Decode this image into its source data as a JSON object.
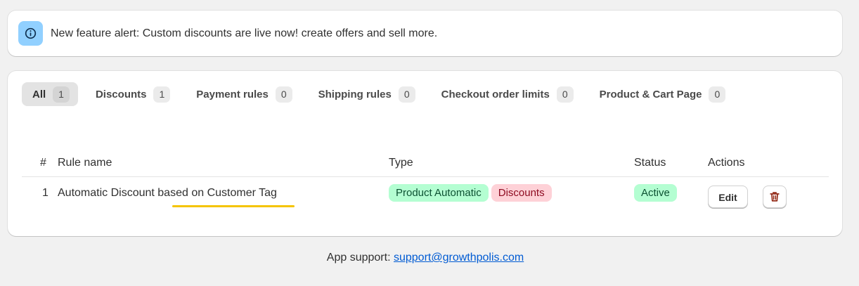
{
  "banner": {
    "text": "New feature alert: Custom discounts are live now! create offers and sell more.",
    "icon": "info-icon"
  },
  "tabs": [
    {
      "label": "All",
      "count": "1"
    },
    {
      "label": "Discounts",
      "count": "1"
    },
    {
      "label": "Payment rules",
      "count": "0"
    },
    {
      "label": "Shipping rules",
      "count": "0"
    },
    {
      "label": "Checkout order limits",
      "count": "0"
    },
    {
      "label": "Product & Cart Page",
      "count": "0"
    }
  ],
  "table": {
    "headers": {
      "num": "#",
      "name": "Rule name",
      "type": "Type",
      "status": "Status",
      "actions": "Actions"
    },
    "rows": [
      {
        "num": "1",
        "name": "Automatic Discount based on Customer Tag",
        "types": [
          "Product Automatic",
          "Discounts"
        ],
        "status": "Active",
        "edit_label": "Edit"
      }
    ]
  },
  "footer": {
    "label": "App support:",
    "email": "support@growthpolis.com"
  },
  "colors": {
    "accent_yellow": "#f5c400",
    "success_bg": "#b4fed2",
    "critical_bg": "#fed1d7",
    "link": "#005bd3",
    "info_icon_bg": "#91d0ff"
  }
}
